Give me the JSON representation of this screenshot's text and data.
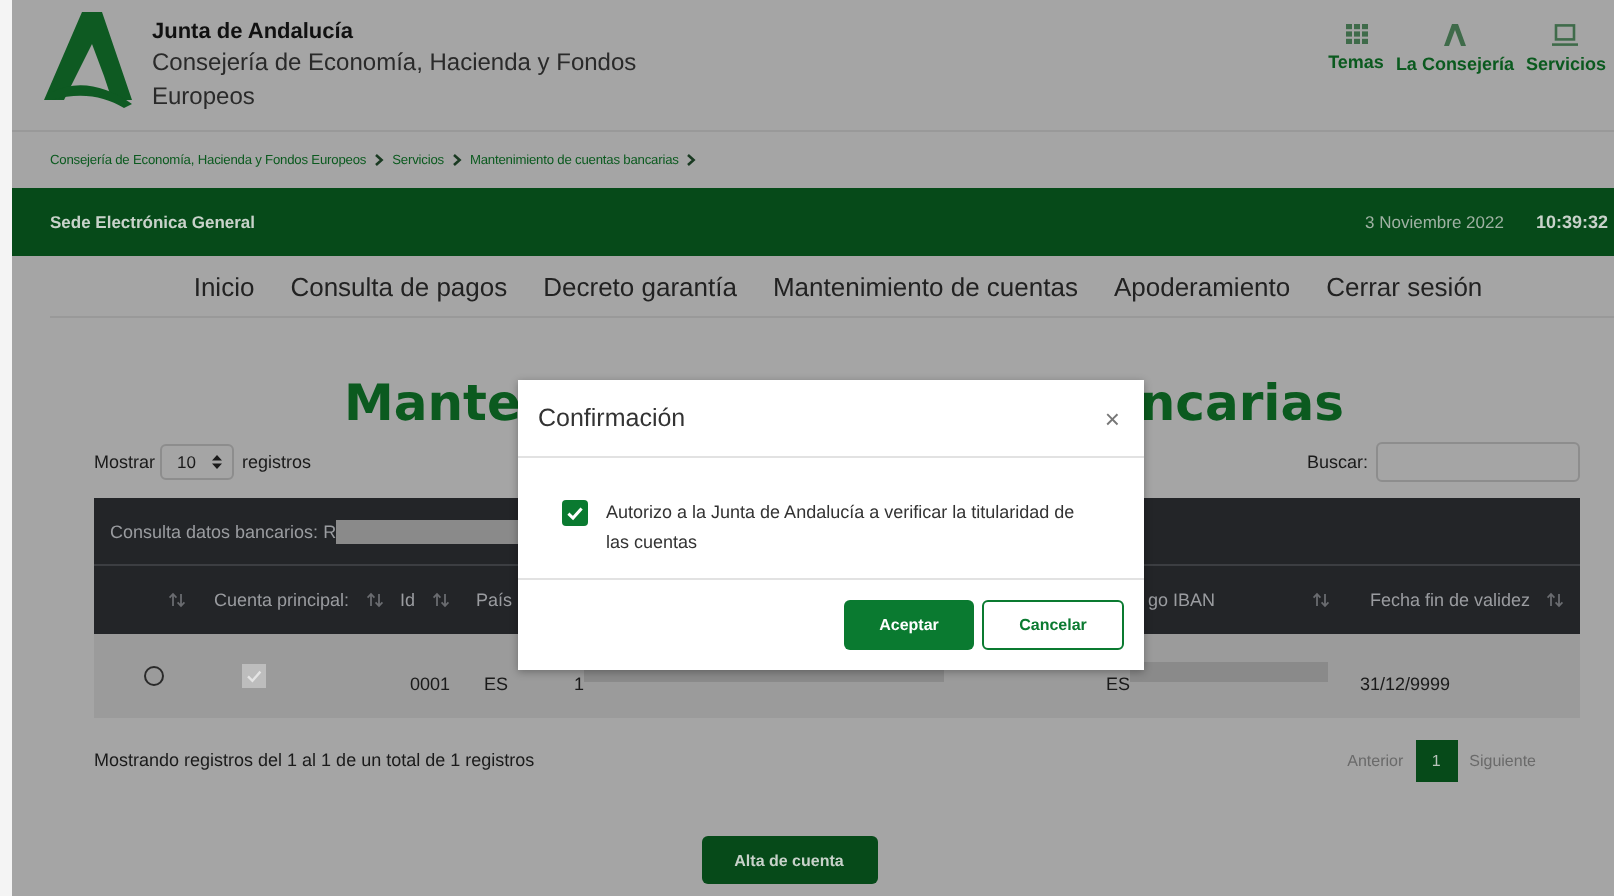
{
  "header": {
    "organization": "Junta de Andalucía",
    "department": "Consejería de Economía, Hacienda y Fondos Europeos",
    "links": [
      {
        "label": "Temas",
        "kind": "grid"
      },
      {
        "label": "La Consejería",
        "kind": "logo"
      },
      {
        "label": "Servicios",
        "kind": "laptop"
      }
    ]
  },
  "breadcrumb": [
    "Consejería de Economía, Hacienda y Fondos Europeos",
    "Servicios",
    "Mantenimiento de cuentas bancarias"
  ],
  "top_bar": {
    "title": "Sede Electrónica General",
    "date": "3 Noviembre 2022",
    "time": "10:39:32"
  },
  "nav": [
    "Inicio",
    "Consulta de pagos",
    "Decreto garantía",
    "Mantenimiento de cuentas",
    "Apoderamiento",
    "Cerrar sesión"
  ],
  "page_title": {
    "visible_start": "Mante",
    "visible_end": "ncarias"
  },
  "length_control": {
    "label_before": "Mostrar",
    "value": "10",
    "label_after": "registros"
  },
  "search": {
    "label": "Buscar:"
  },
  "table": {
    "caption": "Consulta datos bancarios: R",
    "columns": [
      {
        "sortable": true
      },
      {
        "label": "Cuenta principal:",
        "sortable": true
      },
      {
        "label": "Id",
        "sortable": true
      },
      {
        "label": "País",
        "sortable": false
      },
      {
        "label": "go IBAN",
        "sortable": true
      },
      {
        "label": "Fecha fin de validez",
        "sortable": true
      }
    ],
    "rows": [
      {
        "selected": false,
        "principal": true,
        "id": "0001",
        "country": "ES",
        "account": "1",
        "iban": "ES",
        "end_date": "31/12/9999"
      }
    ]
  },
  "info": "Mostrando registros del 1 al 1 de un total de 1 registros",
  "pagination": {
    "previous": "Anterior",
    "pages": [
      {
        "label": "1",
        "selected": true
      }
    ],
    "next": "Siguiente"
  },
  "add_button": "Alta de cuenta",
  "modal": {
    "title": "Confirmación",
    "close": "×",
    "consent": {
      "checked": true,
      "text": "Autorizo a la Junta de Andalucía a verificar la titularidad de las cuentas"
    },
    "buttons": [
      {
        "label": "Aceptar",
        "kind": "primary"
      },
      {
        "label": "Cancelar",
        "kind": "secondary"
      }
    ]
  }
}
